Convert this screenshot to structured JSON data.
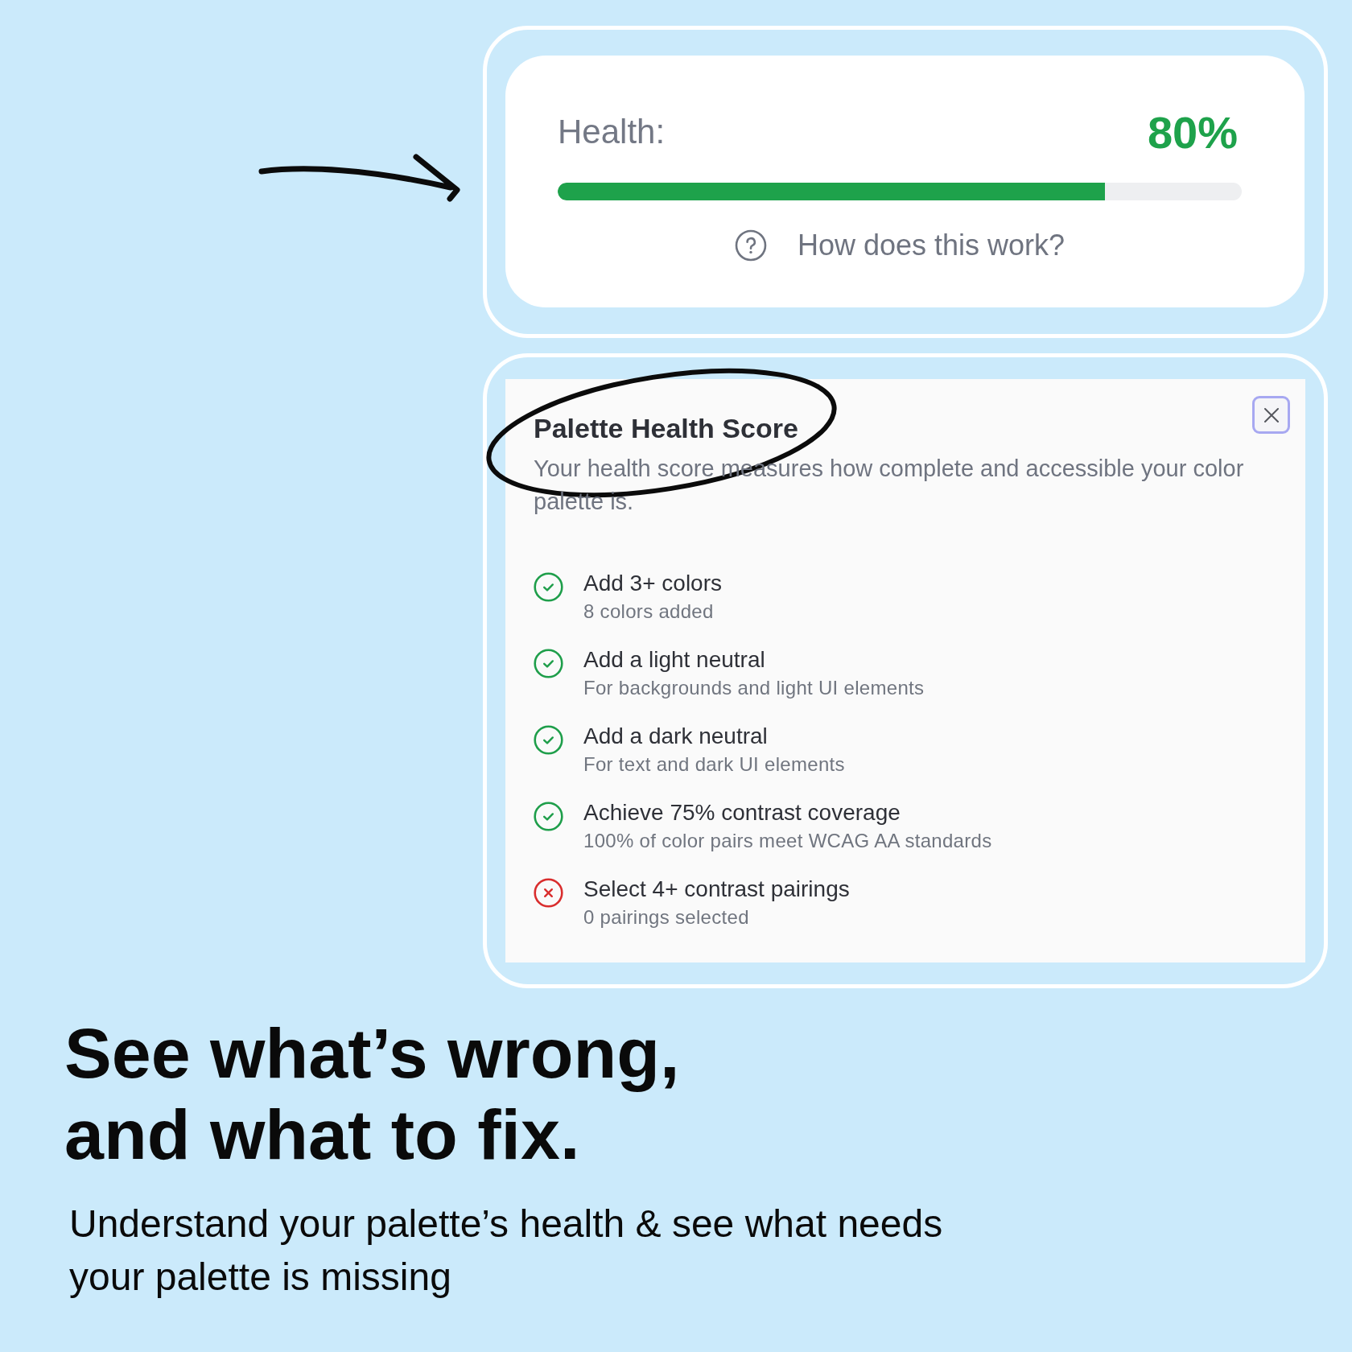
{
  "health_card": {
    "label": "Health:",
    "value": "80%",
    "level": 0.8,
    "help_link": "How does this work?"
  },
  "score_panel": {
    "title": "Palette Health Score",
    "description": "Your health score measures how complete and accessible your color palette is.",
    "checklist": [
      {
        "title": "Add 3+ colors",
        "detail": "8 colors added",
        "met": true
      },
      {
        "title": "Add a light neutral",
        "detail": "For backgrounds and light UI elements",
        "met": true
      },
      {
        "title": "Add a dark neutral",
        "detail": "For text and dark UI elements",
        "met": true
      },
      {
        "title": "Achieve 75% contrast coverage",
        "detail": "100% of color pairs meet WCAG AA standards",
        "met": true
      },
      {
        "title": "Select 4+ contrast pairings",
        "detail": "0 pairings selected",
        "met": false
      }
    ]
  },
  "headline": {
    "lines": [
      "See what’s wrong,",
      "and what to fix."
    ]
  },
  "subheadline": {
    "lines": [
      "Understand your palette’s health & see what needs",
      "your palette is missing"
    ]
  }
}
